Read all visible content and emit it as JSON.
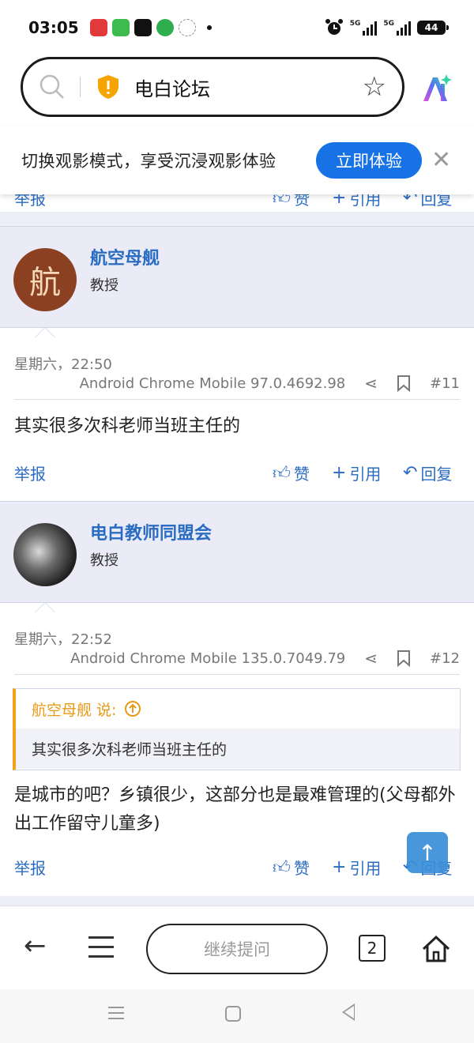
{
  "status_bar": {
    "time": "03:05",
    "network_1": "5G",
    "network_2": "5G",
    "battery": "44"
  },
  "address_bar": {
    "site_title": "电白论坛"
  },
  "banner": {
    "text": "切换观影模式，享受沉浸观影体验",
    "button_label": "立即体验"
  },
  "actions": {
    "report": "举报",
    "like": "赞",
    "quote": "引用",
    "reply": "回复"
  },
  "posts": [
    {
      "avatar_char": "航",
      "username": "航空母舰",
      "role": "教授",
      "time": "星期六，22:50",
      "agent": "Android Chrome Mobile 97.0.4692.98",
      "number": "#11",
      "body": "其实很多次科老师当班主任的"
    },
    {
      "username": "电白教师同盟会",
      "role": "教授",
      "time": "星期六，22:52",
      "agent": "Android Chrome Mobile 135.0.7049.79",
      "number": "#12",
      "quote_author": "航空母舰 说:",
      "quote_text": "其实很多次科老师当班主任的",
      "body": "是城市的吧？乡镇很少，这部分也是最难管理的(父母都外出工作留守儿童多)"
    }
  ],
  "bottom_nav": {
    "ask_placeholder": "继续提问",
    "tab_count": "2"
  },
  "colors": {
    "link_blue": "#2a6cc2",
    "banner_button": "#1772e6",
    "quote_accent": "#f0a31b",
    "header_bg": "#eaebf6"
  }
}
